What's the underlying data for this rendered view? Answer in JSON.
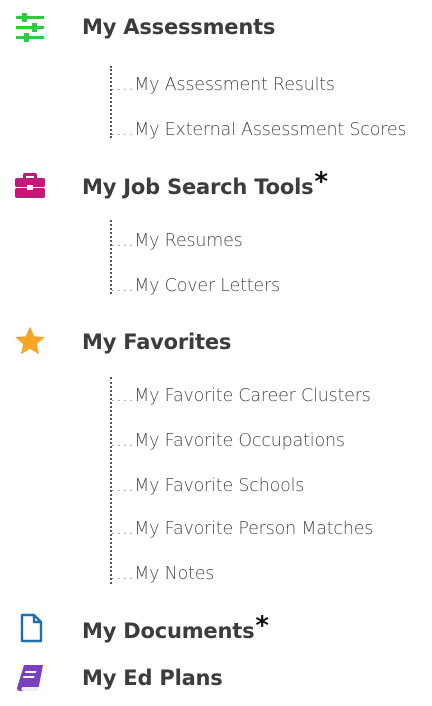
{
  "sections": [
    {
      "title": "My Assessments",
      "icon": "sliders-icon",
      "icon_color": "#2ecc40",
      "required": false,
      "items": [
        "My Assessment Results",
        "My External Assessment Scores"
      ]
    },
    {
      "title": "My Job Search Tools",
      "icon": "briefcase-icon",
      "icon_color": "#c2187a",
      "required": true,
      "items": [
        "My Resumes",
        "My Cover Letters"
      ]
    },
    {
      "title": "My Favorites",
      "icon": "star-icon",
      "icon_color": "#f5a623",
      "required": false,
      "items": [
        "My Favorite Career Clusters",
        "My Favorite Occupations",
        "My Favorite Schools",
        "My Favorite Person Matches",
        "My Notes"
      ]
    },
    {
      "title": "My Documents",
      "icon": "document-icon",
      "icon_color": "#1f6fa8",
      "required": true,
      "items": []
    },
    {
      "title": "My Ed Plans",
      "icon": "book-icon",
      "icon_color": "#7a3fbf",
      "required": false,
      "items": []
    }
  ],
  "required_marker": "*",
  "item_leader": "...."
}
